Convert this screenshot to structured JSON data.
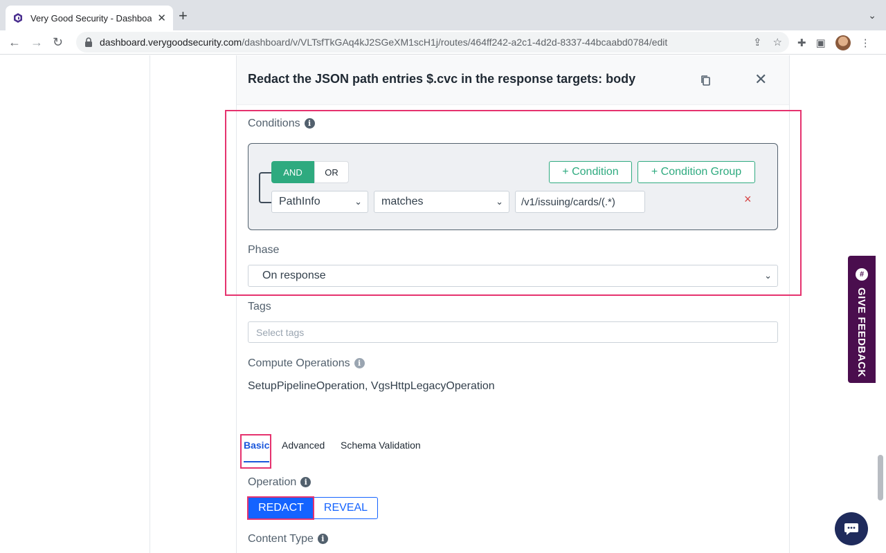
{
  "browser": {
    "tab_title": "Very Good Security - Dashboard",
    "url_host": "dashboard.verygoodsecurity.com",
    "url_path": "/dashboard/v/VLTsfTkGAq4kJ2SGeXM1scH1j/routes/464ff242-a2c1-4d2d-8337-44bcaabd0784/edit"
  },
  "panel": {
    "title": "Redact the JSON path entries $.cvc in the response targets: body"
  },
  "conditions": {
    "label": "Conditions",
    "and_label": "AND",
    "or_label": "OR",
    "add_condition": "+ Condition",
    "add_condition_group": "+ Condition Group",
    "field_value": "PathInfo",
    "operator_value": "matches",
    "pattern_value": "/v1/issuing/cards/(.*)",
    "remove_label": "×"
  },
  "phase": {
    "label": "Phase",
    "value": "On response"
  },
  "tags": {
    "label": "Tags",
    "placeholder": "Select tags"
  },
  "compute": {
    "label": "Compute Operations",
    "value": "SetupPipelineOperation, VgsHttpLegacyOperation"
  },
  "tabs": [
    "Basic",
    "Advanced",
    "Schema Validation"
  ],
  "operation": {
    "label": "Operation",
    "redact": "REDACT",
    "reveal": "REVEAL"
  },
  "content_type": {
    "label": "Content Type"
  },
  "feedback": {
    "label": "GIVE FEEDBACK"
  },
  "colors": {
    "green": "#2eaa7f",
    "blue": "#1463ff",
    "highlight": "#e5326e",
    "feedback_bg": "#4a0e4e"
  }
}
